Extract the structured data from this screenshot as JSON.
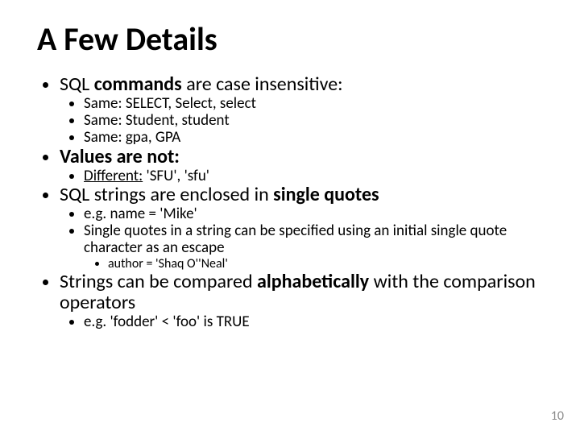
{
  "title": "A Few Details",
  "bullets": {
    "b1": {
      "pre": "SQL ",
      "bold": "commands",
      "post": " are case insensitive:",
      "s1": "Same: SELECT,  Select,  select",
      "s2": "Same: Student,  student",
      "s3": "Same: gpa,  GPA"
    },
    "b2": {
      "bold": "Values are not:",
      "s1_u": "Different:",
      "s1_rest": " 'SFU', 'sfu'"
    },
    "b3": {
      "pre": "SQL strings are enclosed in ",
      "bold": "single quotes",
      "s1": "e.g. name = 'Mike'",
      "s2": "Single quotes in a string can be specified using an initial single quote character as an escape",
      "s2a": "author = 'Shaq O''Neal'"
    },
    "b4": {
      "pre": "Strings can be compared ",
      "bold": "alphabetically",
      "post": " with the comparison operators",
      "s1": "e.g. 'fodder' < 'foo' is TRUE"
    }
  },
  "pagenum": "10"
}
